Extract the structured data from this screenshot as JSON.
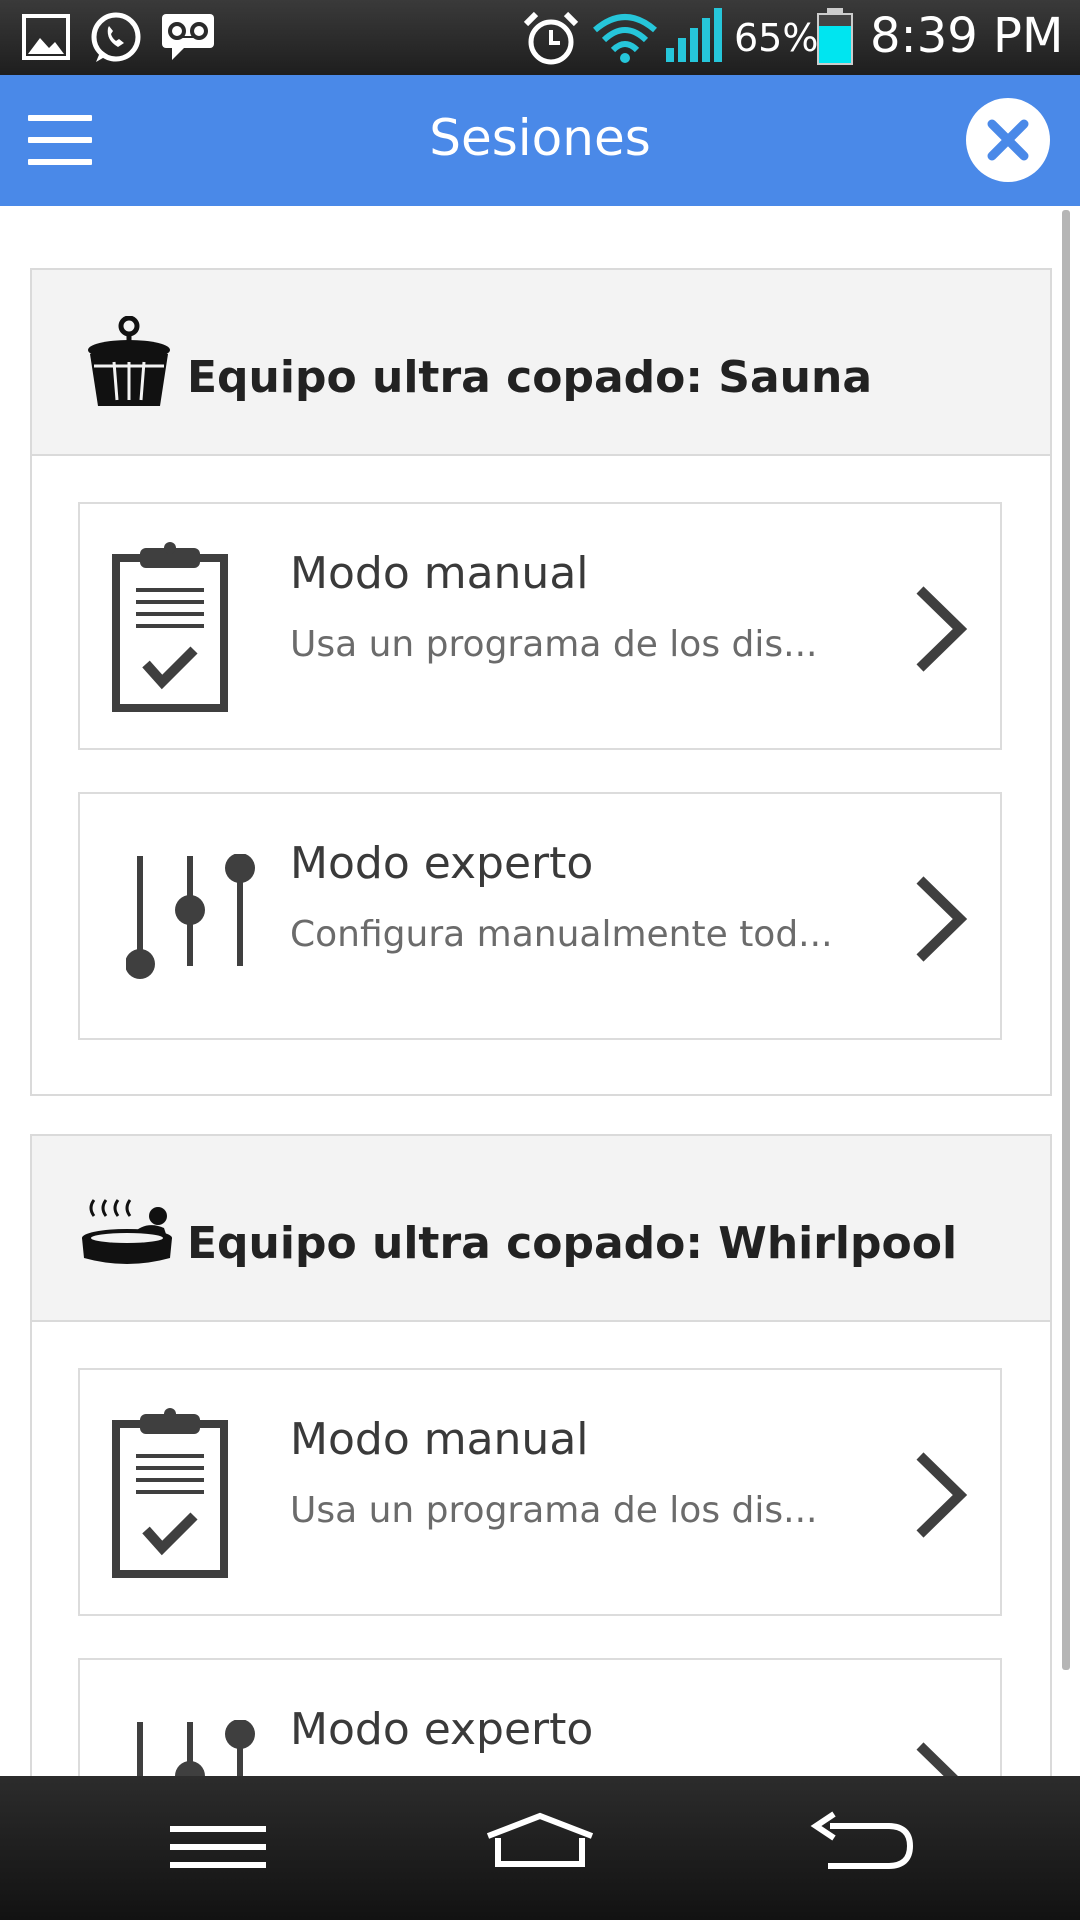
{
  "status_bar": {
    "battery_percent": "65%",
    "time": "8:39 PM",
    "icons": [
      "gallery-icon",
      "whatsapp-icon",
      "voicemail-icon",
      "alarm-icon",
      "wifi-icon",
      "signal-icon",
      "battery-icon"
    ],
    "battery_color": "#00e5f0"
  },
  "app_bar": {
    "title": "Sesiones",
    "color": "#4a89e8",
    "menu_icon": "hamburger-menu-icon",
    "close_icon": "close-icon"
  },
  "sections": [
    {
      "title": "Equipo ultra copado: Sauna",
      "icon": "sauna-bucket-icon",
      "options": [
        {
          "title": "Modo manual",
          "description": "Usa un programa de los dis...",
          "icon": "clipboard-check-icon"
        },
        {
          "title": "Modo experto",
          "description": "Configura manualmente tod...",
          "icon": "sliders-icon"
        }
      ]
    },
    {
      "title": "Equipo ultra copado: Whirlpool",
      "icon": "whirlpool-tub-icon",
      "options": [
        {
          "title": "Modo manual",
          "description": "Usa un programa de los dis...",
          "icon": "clipboard-check-icon"
        },
        {
          "title": "Modo experto",
          "description": "",
          "icon": "sliders-icon"
        }
      ]
    }
  ],
  "nav_bar": {
    "buttons": [
      "menu-icon",
      "home-icon",
      "back-icon"
    ]
  }
}
